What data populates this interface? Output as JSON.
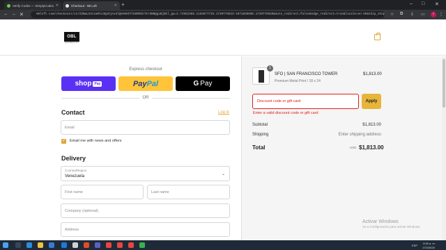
{
  "browser": {
    "tabs": [
      {
        "label": "Verify Codes — SimplyCodes",
        "active": false,
        "favicon_color": "#6ad04e"
      },
      {
        "label": "Checkout - 08 Loft",
        "active": true,
        "favicon_color": "#e8e8e8"
      }
    ],
    "new_tab": "+",
    "url": "08loft.com/checkouts/cn/Z2NwLXVzLWVhc3QxOjAxSlQ5ANVGTlG8RM1k?kr6NNQgxBjBCl_ga=2.74552386.1163677725.1739775923-1971856608.1739775920&auto_redirect=false&edge_redirect=true&locale=en-VE&skip_shop_pay=true",
    "profile_initial": "!"
  },
  "store": {
    "logo_text": "OBL",
    "logo_subtext": "www.08loft.com",
    "cart_icon": "shopping-bag-icon",
    "accent": "#e0a73a"
  },
  "express": {
    "title": "Express checkout",
    "shop_pay": "shop",
    "shop_pay_pill": "Pay",
    "paypal_a": "Pay",
    "paypal_b": "Pal",
    "gpay_g": "G",
    "gpay": "Pay",
    "or": "OR"
  },
  "contact": {
    "heading": "Contact",
    "login_link": "Log in",
    "email_placeholder": "Email",
    "newsletter_label": "Email me with news and offers",
    "newsletter_checked": true
  },
  "delivery": {
    "heading": "Delivery",
    "country_label": "Country/Region",
    "country_value": "Venezuela",
    "first_name_placeholder": "First name",
    "last_name_placeholder": "Last name",
    "company_placeholder": "Company (optional)",
    "address_placeholder": "Address"
  },
  "order": {
    "quantity": "1",
    "product_name": "SFO | SAN FRANCISCO TOWER",
    "product_variant": "Premium Metal Print / 18 x 24",
    "product_price": "$1,813.00",
    "discount_placeholder": "Discount code or gift card",
    "apply_label": "Apply",
    "discount_error": "Enter a valid discount code or gift card",
    "subtotal_label": "Subtotal",
    "subtotal_value": "$1,813.00",
    "shipping_label": "Shipping",
    "shipping_value": "Enter shipping address",
    "total_label": "Total",
    "total_currency": "USD",
    "total_value": "$1,813.00",
    "error_color": "#dd1d1d"
  },
  "os": {
    "watermark_title": "Activar Windows",
    "watermark_sub": "Ve a Configuración para activar Windows.",
    "lang": "ESP",
    "time": "3:05 a. m.",
    "date": "17/2/2025"
  }
}
